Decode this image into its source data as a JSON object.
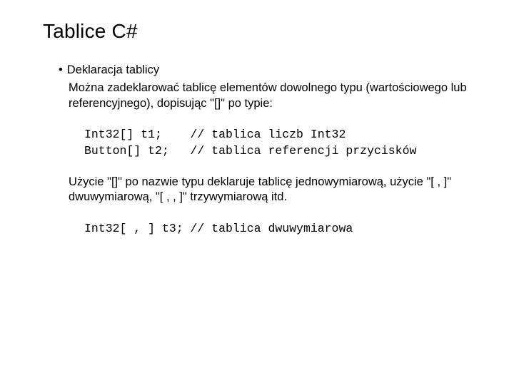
{
  "title": "Tablice C#",
  "bullet": "•",
  "p1": "Deklaracja tablicy",
  "p2": "Można zadeklarować tablicę elementów dowolnego typu (wartościowego lub referencyjnego), dopisując \"[]\" po typie:",
  "code1": "Int32[] t1;    // tablica liczb Int32\nButton[] t2;   // tablica referencji przycisków",
  "p3": "Użycie \"[]\" po nazwie typu deklaruje tablicę jednowymiarową, użycie \"[ , ]\" dwuwymiarową, \"[ , , ]\" trzywymiarową itd.",
  "code2": "Int32[ , ] t3; // tablica dwuwymiarowa"
}
